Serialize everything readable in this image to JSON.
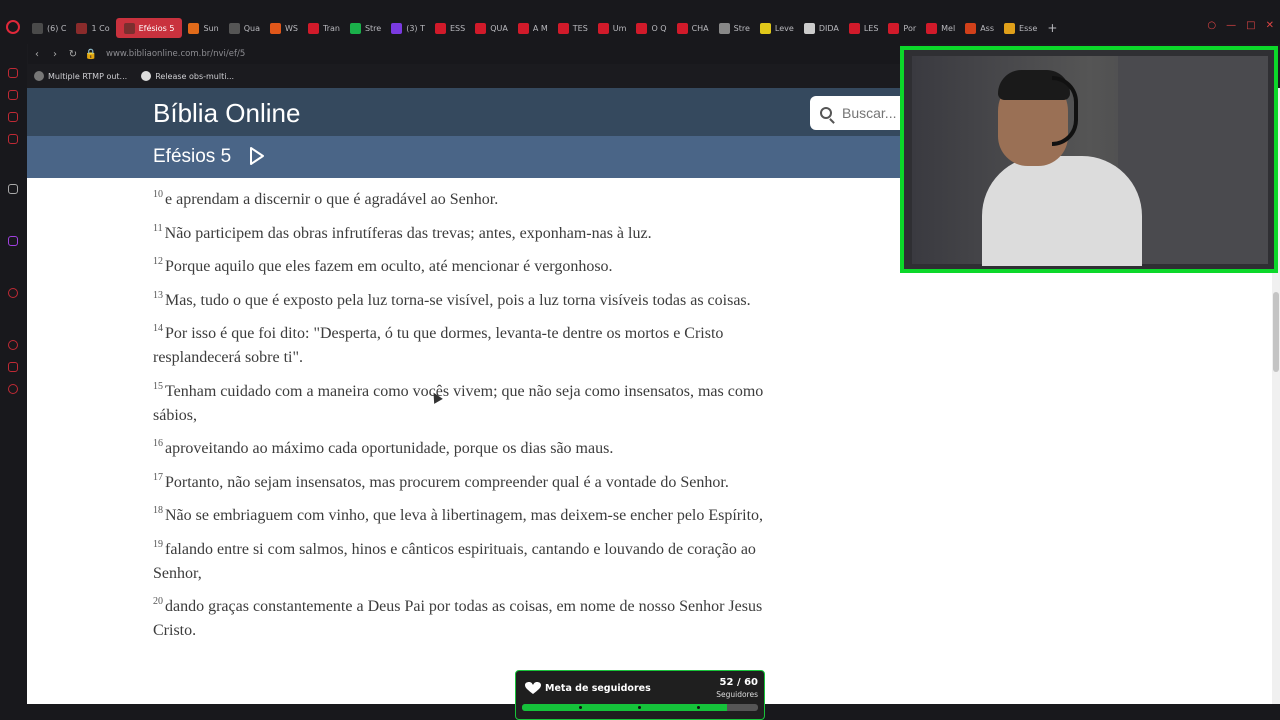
{
  "browser": {
    "tabs": [
      {
        "label": "(6) C",
        "color": "#4a4a4a"
      },
      {
        "label": "1 Co",
        "color": "#8a2b2b"
      },
      {
        "label": "Efésios 5",
        "color": "#7a2f2f",
        "active": true
      },
      {
        "label": "Sun",
        "color": "#e06a1a"
      },
      {
        "label": "Qua",
        "color": "#555555"
      },
      {
        "label": "WS",
        "color": "#e0571a"
      },
      {
        "label": "Tran",
        "color": "#d11a2a"
      },
      {
        "label": "Stre",
        "color": "#1ab04a"
      },
      {
        "label": "(3) T",
        "color": "#7a3ae0"
      },
      {
        "label": "ESS",
        "color": "#d11a2a"
      },
      {
        "label": "QUA",
        "color": "#d11a2a"
      },
      {
        "label": "A M",
        "color": "#d11a2a"
      },
      {
        "label": "TES",
        "color": "#d11a2a"
      },
      {
        "label": "Um",
        "color": "#d11a2a"
      },
      {
        "label": "O Q",
        "color": "#d11a2a"
      },
      {
        "label": "CHA",
        "color": "#d11a2a"
      },
      {
        "label": "Stre",
        "color": "#888888"
      },
      {
        "label": "Leve",
        "color": "#e0c81a"
      },
      {
        "label": "DIDA",
        "color": "#cccccc"
      },
      {
        "label": "LES",
        "color": "#d11a2a"
      },
      {
        "label": "Por",
        "color": "#d11a2a"
      },
      {
        "label": "Mel",
        "color": "#d11a2a"
      },
      {
        "label": "Ass",
        "color": "#d1401a"
      },
      {
        "label": "Esse",
        "color": "#e0a01a"
      }
    ],
    "url": "www.bibliaonline.com.br/nvi/ef/5",
    "bookmarks": [
      "Multiple RTMP out...",
      "Release obs-multi..."
    ]
  },
  "site": {
    "title": "Bíblia Online",
    "search_placeholder": "Buscar...",
    "chapter": "Efésios 5"
  },
  "verses": [
    {
      "num": "10",
      "text": "e aprendam a discernir o que é agradável ao Senhor."
    },
    {
      "num": "11",
      "text": "Não participem das obras infrutíferas das trevas; antes, exponham-nas à luz."
    },
    {
      "num": "12",
      "text": "Porque aquilo que eles fazem em oculto, até mencionar é vergonhoso."
    },
    {
      "num": "13",
      "text": "Mas, tudo o que é exposto pela luz torna-se visível, pois a luz torna visíveis todas as coisas."
    },
    {
      "num": "14",
      "text": "Por isso é que foi dito: \"Desperta, ó tu que dormes, levanta-te dentre os mortos e Cristo resplandecerá sobre ti\"."
    },
    {
      "num": "15",
      "text": "Tenham cuidado com a maneira como vocês vivem; que não seja como insensatos, mas como sábios,"
    },
    {
      "num": "16",
      "text": "aproveitando ao máximo cada oportunidade, porque os dias são maus."
    },
    {
      "num": "17",
      "text": "Portanto, não sejam insensatos, mas procurem compreender qual é a vontade do Senhor."
    },
    {
      "num": "18",
      "text": "Não se embriaguem com vinho, que leva à libertinagem, mas deixem-se encher pelo Espírito,"
    },
    {
      "num": "19",
      "text": "falando entre si com salmos, hinos e cânticos espirituais, cantando e louvando de coração ao Senhor,"
    },
    {
      "num": "20",
      "text": "dando graças constantemente a Deus Pai por todas as coisas, em nome de nosso Senhor Jesus Cristo."
    }
  ],
  "goal_widget": {
    "label": "Meta de seguidores",
    "count": "52 / 60",
    "unit": "Seguidores",
    "progress": 0.8667,
    "accent": "#15c23a"
  },
  "colors": {
    "header": "#35495e",
    "chapter_bar": "#4a6587",
    "webcam_border": "#0cd82a"
  }
}
